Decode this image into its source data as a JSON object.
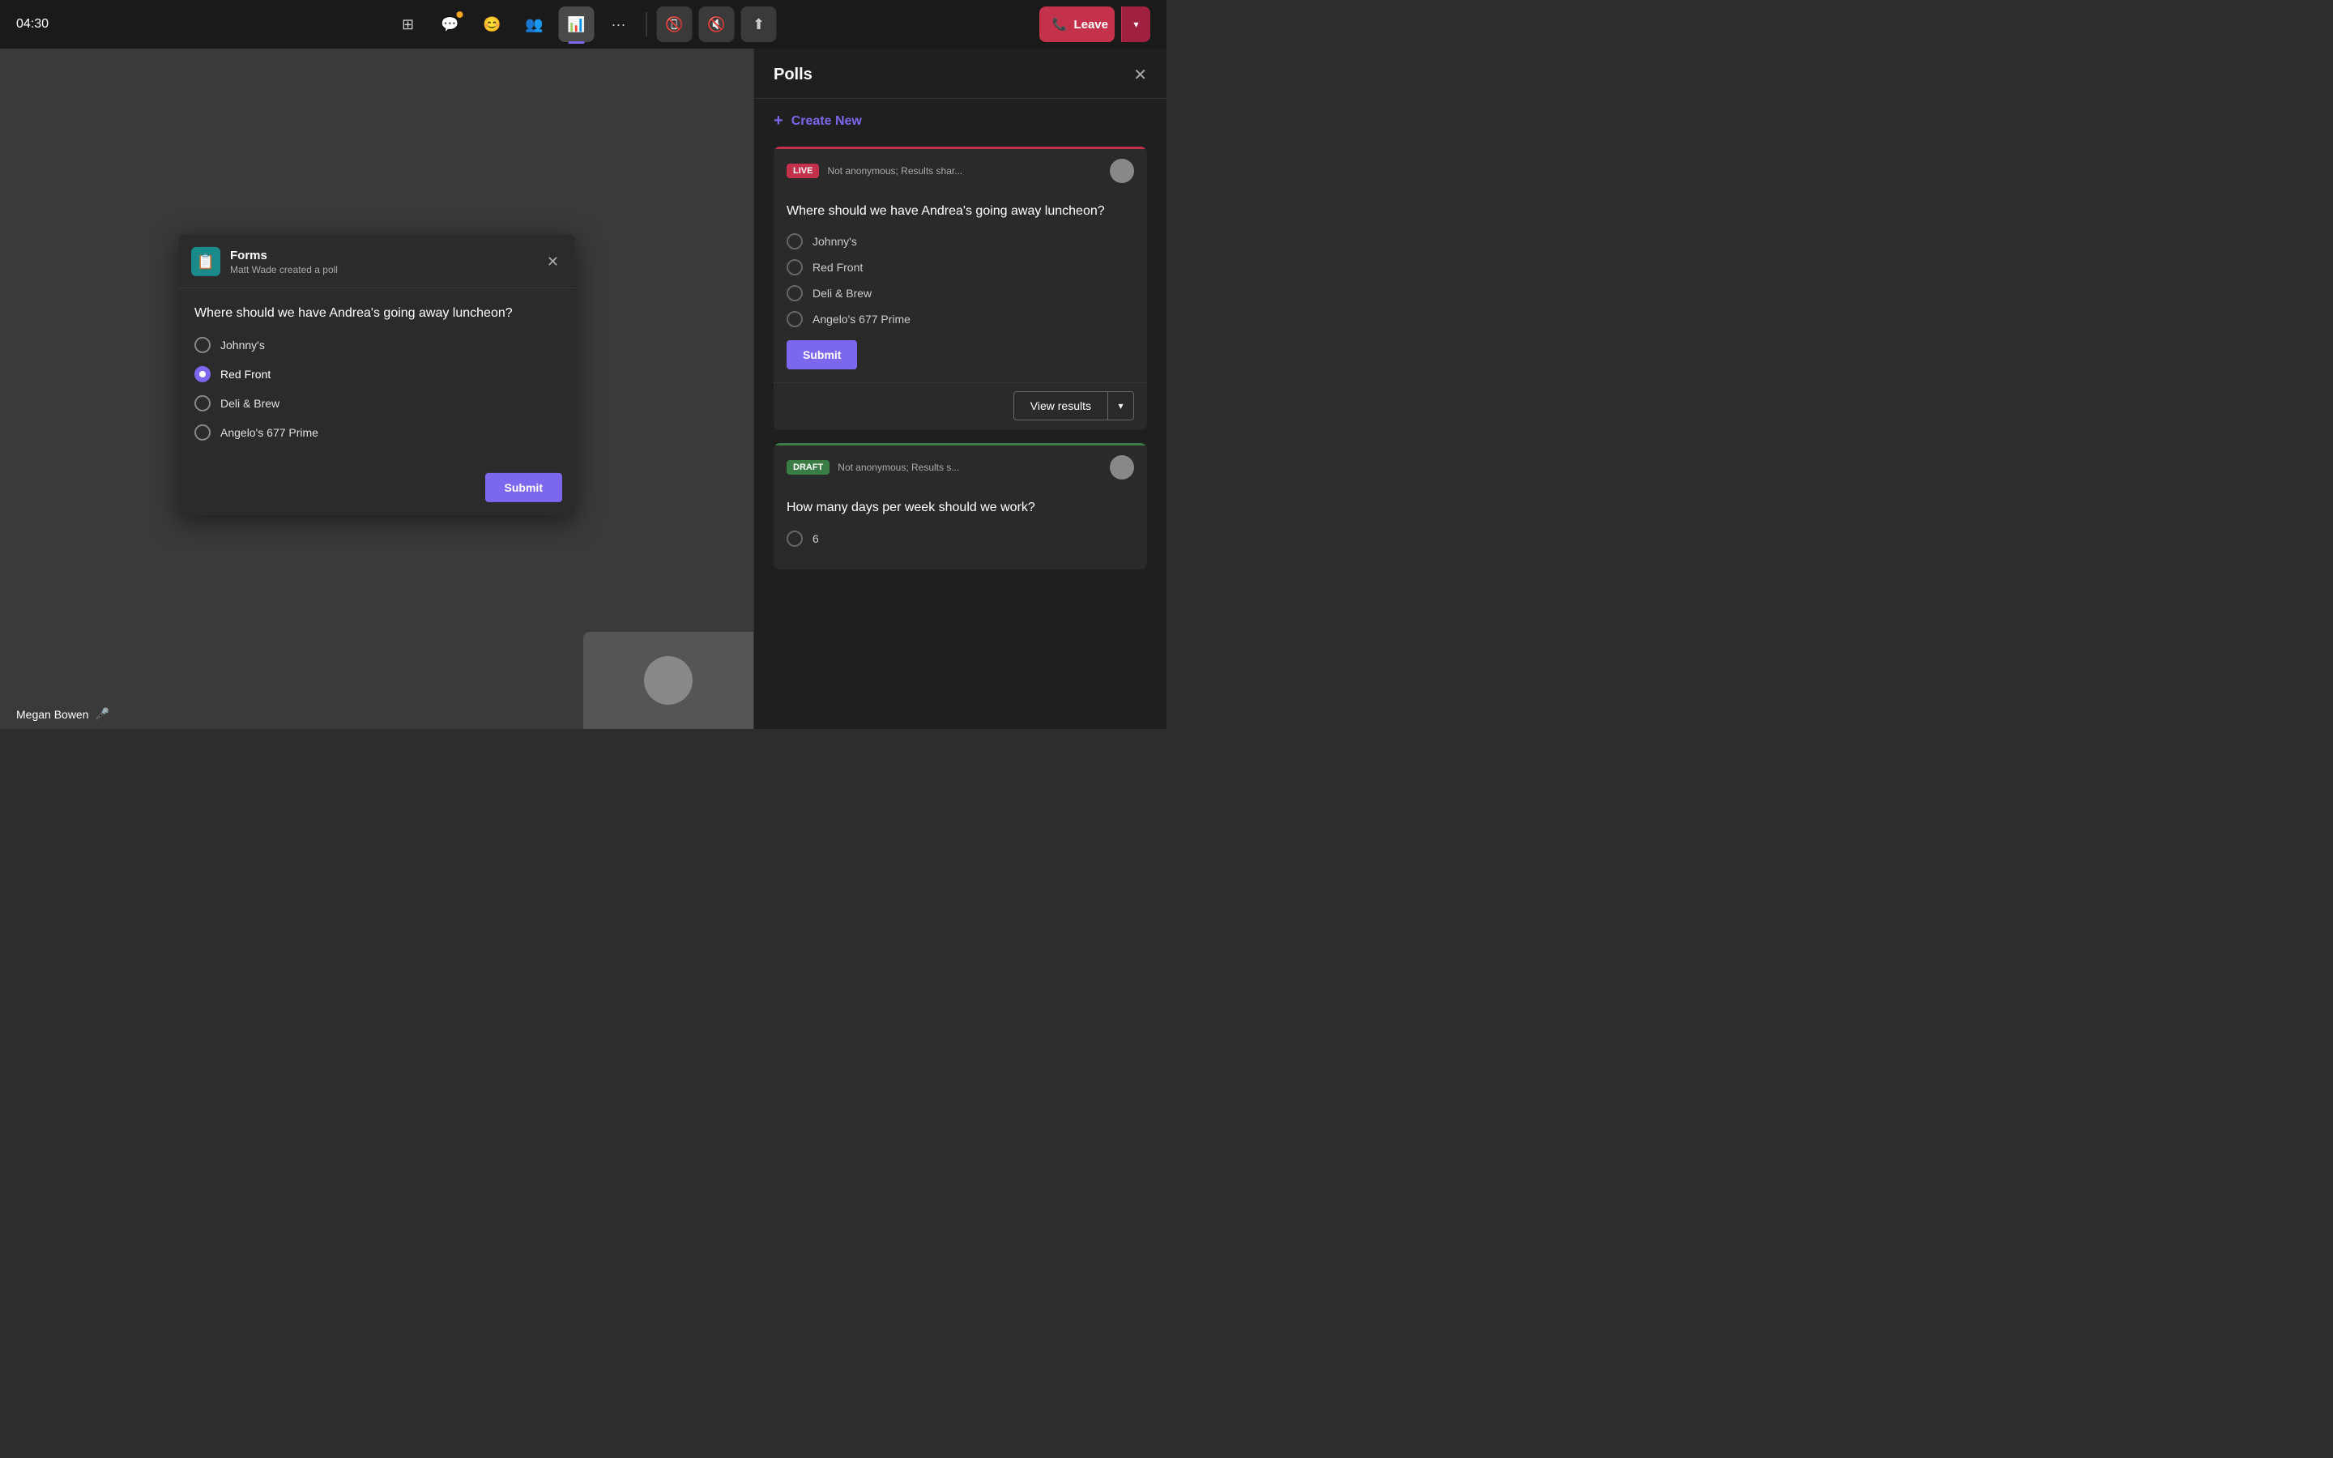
{
  "topbar": {
    "timer": "04:30",
    "icons": [
      {
        "name": "grid-icon",
        "symbol": "⊞",
        "active": false,
        "badge": false
      },
      {
        "name": "chat-icon",
        "symbol": "💬",
        "active": false,
        "badge": true
      },
      {
        "name": "emoji-icon",
        "symbol": "😊",
        "active": false,
        "badge": false
      },
      {
        "name": "participants-icon",
        "symbol": "👥",
        "active": false,
        "badge": false
      },
      {
        "name": "present-icon",
        "symbol": "📊",
        "active": true,
        "badge": false
      },
      {
        "name": "more-icon",
        "symbol": "···",
        "active": false,
        "badge": false
      }
    ],
    "controls": [
      {
        "name": "camera-icon",
        "symbol": "📷"
      },
      {
        "name": "mic-icon",
        "symbol": "🎤"
      },
      {
        "name": "share-icon",
        "symbol": "⬆"
      }
    ],
    "leave_label": "Leave"
  },
  "popup": {
    "icon": "📋",
    "title": "Forms",
    "subtitle": "Matt Wade created a poll",
    "question": "Where should we have Andrea's going away luncheon?",
    "options": [
      {
        "label": "Johnny's",
        "selected": false
      },
      {
        "label": "Red Front",
        "selected": true
      },
      {
        "label": "Deli & Brew",
        "selected": false
      },
      {
        "label": "Angelo's 677 Prime",
        "selected": false
      }
    ],
    "submit_label": "Submit"
  },
  "user_label": {
    "name": "Megan Bowen",
    "mic_icon": "🎤"
  },
  "polls_panel": {
    "title": "Polls",
    "create_new_label": "Create New",
    "close_icon": "✕",
    "live_poll": {
      "badge": "LIVE",
      "meta": "Not anonymous; Results shar...",
      "question": "Where should we have Andrea's going away luncheon?",
      "options": [
        {
          "label": "Johnny's"
        },
        {
          "label": "Red Front"
        },
        {
          "label": "Deli & Brew"
        },
        {
          "label": "Angelo's 677 Prime"
        }
      ],
      "submit_label": "Submit",
      "view_results_label": "View results"
    },
    "draft_poll": {
      "badge": "DRAFT",
      "meta": "Not anonymous; Results s...",
      "question": "How many days per week should we work?",
      "options": [
        {
          "label": "6"
        }
      ]
    }
  }
}
